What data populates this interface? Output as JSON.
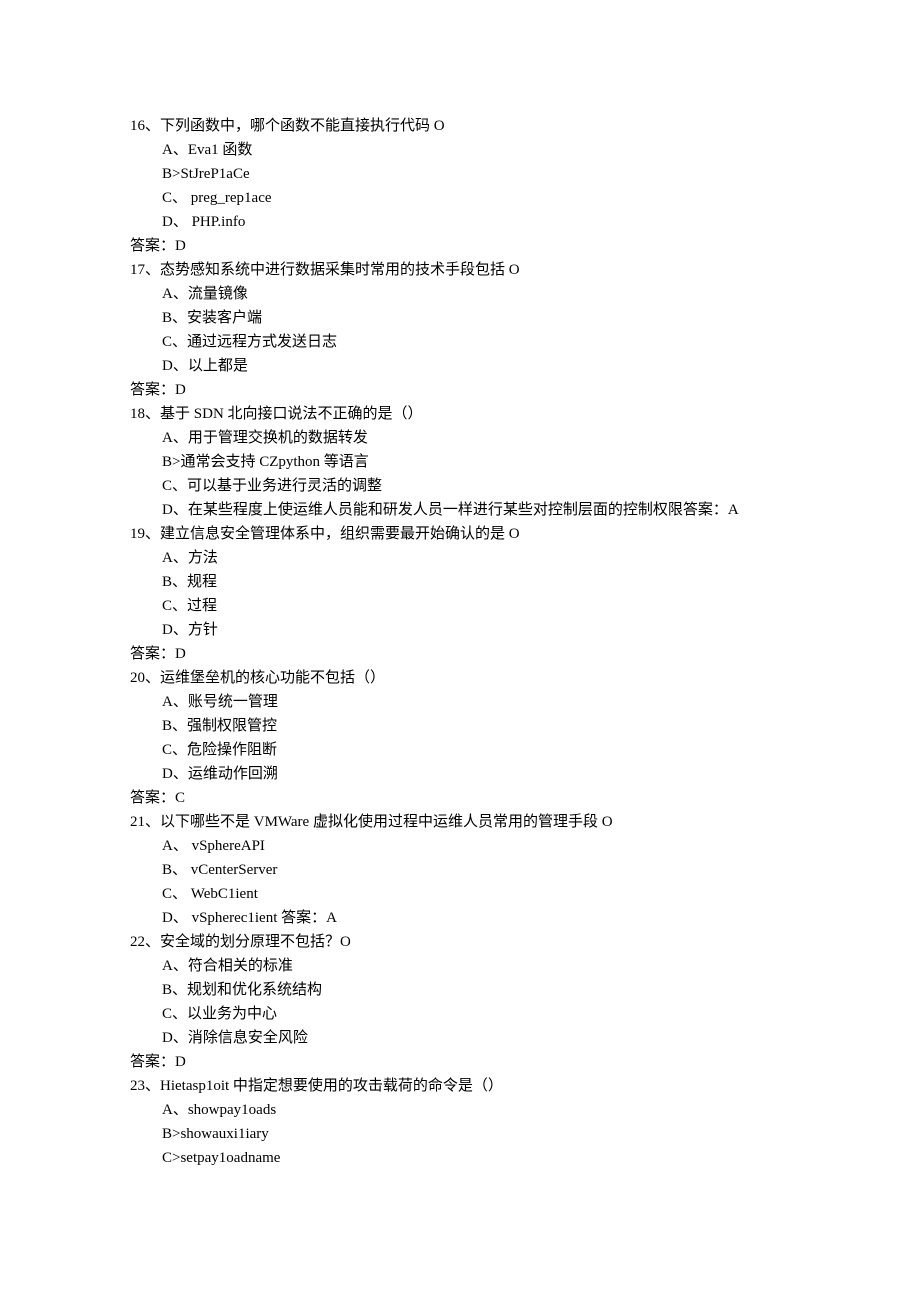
{
  "questions": [
    {
      "number": "16",
      "stem": "下列函数中，哪个函数不能直接执行代码 O",
      "options": [
        "A、Eva1 函数",
        "B>StJreP1aCe",
        "C、 preg_rep1ace",
        "D、 PHP.info"
      ],
      "answer": "答案：D"
    },
    {
      "number": "17",
      "stem": "态势感知系统中进行数据采集时常用的技术手段包括 O",
      "options": [
        "A、流量镜像",
        "B、安装客户端",
        "C、通过远程方式发送日志",
        "D、以上都是"
      ],
      "answer": "答案：D"
    },
    {
      "number": "18",
      "stem": "基于 SDN 北向接口说法不正确的是（）",
      "options": [
        "A、用于管理交换机的数据转发",
        "B>通常会支持 CZpython 等语言",
        "C、可以基于业务进行灵活的调整",
        "D、在某些程度上使运维人员能和研发人员一样进行某些对控制层面的控制权限答案：A"
      ],
      "answer": null
    },
    {
      "number": "19",
      "stem": "建立信息安全管理体系中，组织需要最开始确认的是 O",
      "options": [
        "A、方法",
        "B、规程",
        "C、过程",
        "D、方针"
      ],
      "answer": "答案：D"
    },
    {
      "number": "20",
      "stem": "运维堡垒机的核心功能不包括（）",
      "options": [
        "A、账号统一管理",
        "B、强制权限管控",
        "C、危险操作阻断",
        "D、运维动作回溯"
      ],
      "answer": "答案：C"
    },
    {
      "number": "21",
      "stem": "以下哪些不是 VMWare 虚拟化使用过程中运维人员常用的管理手段 O",
      "options": [
        "A、 vSphereAPI",
        "B、 vCenterServer",
        "C、 WebC1ient",
        "D、 vSpherec1ient 答案：A"
      ],
      "answer": null
    },
    {
      "number": "22",
      "stem": "安全域的划分原理不包括？O",
      "options": [
        "A、符合相关的标准",
        "B、规划和优化系统结构",
        "C、以业务为中心",
        "D、消除信息安全风险"
      ],
      "answer": "答案：D"
    },
    {
      "number": "23",
      "stem": "Hietasp1oit 中指定想要使用的攻击载荷的命令是（）",
      "options": [
        "A、showpay1oads",
        "B>showauxi1iary",
        "C>setpay1oadname"
      ],
      "answer": null
    }
  ]
}
